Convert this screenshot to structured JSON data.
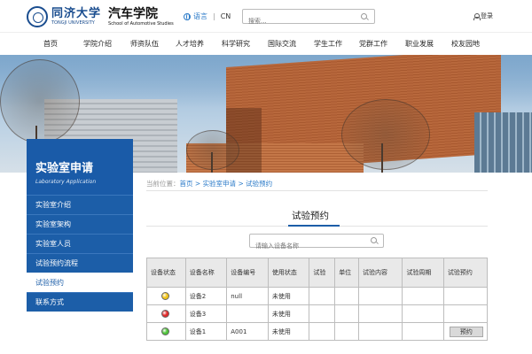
{
  "header": {
    "university_cn": "同济大学",
    "university_en": "TONGJI UNIVERSITY",
    "school_cn": "汽车学院",
    "school_en": "School of Automotive Studies",
    "lang_cn": "语言",
    "lang_sep": "|",
    "lang_en": "CN",
    "search_placeholder": "搜索...",
    "login": "登录"
  },
  "nav": {
    "items": [
      "首页",
      "学院介绍",
      "师资队伍",
      "人才培养",
      "科学研究",
      "国际交流",
      "学生工作",
      "党群工作",
      "职业发展",
      "校友园地"
    ]
  },
  "sidebar": {
    "title": "实验室申请",
    "subtitle": "Laboratory Application",
    "items": [
      "实验室介绍",
      "实验室架构",
      "实验室人员",
      "试验预约流程",
      "试验预约",
      "联系方式"
    ],
    "active_index": 4
  },
  "breadcrumb": {
    "prefix": "当前位置：",
    "home": "首页",
    "sep": " > ",
    "level1": "实验室申请",
    "current": "试验预约"
  },
  "content": {
    "title": "试验预约",
    "search_placeholder": "请输入设备名称"
  },
  "table": {
    "headers": [
      "设备状态",
      "设备名称",
      "设备编号",
      "使用状态",
      "试验",
      "单位",
      "试验内容",
      "试验周期",
      "试验预约"
    ],
    "rows": [
      {
        "status_color": "#f2c418",
        "name": "设备2",
        "code": "null",
        "use": "未使用",
        "book": ""
      },
      {
        "status_color": "#e02a2a",
        "name": "设备3",
        "code": "",
        "use": "未使用",
        "book": ""
      },
      {
        "status_color": "#4fc43a",
        "name": "设备1",
        "code": "A001",
        "use": "未使用",
        "book": "预约"
      }
    ]
  },
  "colors": {
    "primary": "#1c5ea8",
    "link": "#2a7ac8"
  }
}
